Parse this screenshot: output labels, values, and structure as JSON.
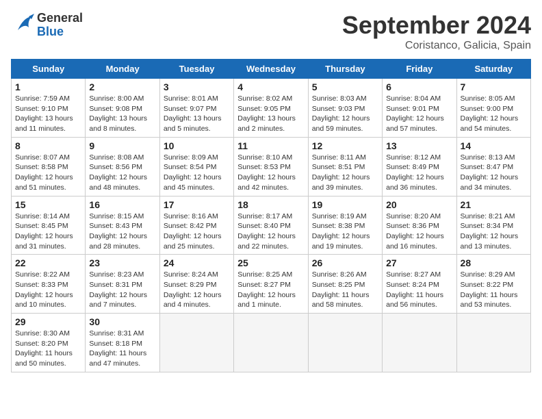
{
  "header": {
    "logo_text_general": "General",
    "logo_text_blue": "Blue",
    "month_title": "September 2024",
    "location": "Coristanco, Galicia, Spain"
  },
  "days_of_week": [
    "Sunday",
    "Monday",
    "Tuesday",
    "Wednesday",
    "Thursday",
    "Friday",
    "Saturday"
  ],
  "weeks": [
    [
      {
        "day": 1,
        "sunrise": "7:59 AM",
        "sunset": "9:10 PM",
        "daylight": "13 hours and 11 minutes."
      },
      {
        "day": 2,
        "sunrise": "8:00 AM",
        "sunset": "9:08 PM",
        "daylight": "13 hours and 8 minutes."
      },
      {
        "day": 3,
        "sunrise": "8:01 AM",
        "sunset": "9:07 PM",
        "daylight": "13 hours and 5 minutes."
      },
      {
        "day": 4,
        "sunrise": "8:02 AM",
        "sunset": "9:05 PM",
        "daylight": "13 hours and 2 minutes."
      },
      {
        "day": 5,
        "sunrise": "8:03 AM",
        "sunset": "9:03 PM",
        "daylight": "12 hours and 59 minutes."
      },
      {
        "day": 6,
        "sunrise": "8:04 AM",
        "sunset": "9:01 PM",
        "daylight": "12 hours and 57 minutes."
      },
      {
        "day": 7,
        "sunrise": "8:05 AM",
        "sunset": "9:00 PM",
        "daylight": "12 hours and 54 minutes."
      }
    ],
    [
      {
        "day": 8,
        "sunrise": "8:07 AM",
        "sunset": "8:58 PM",
        "daylight": "12 hours and 51 minutes."
      },
      {
        "day": 9,
        "sunrise": "8:08 AM",
        "sunset": "8:56 PM",
        "daylight": "12 hours and 48 minutes."
      },
      {
        "day": 10,
        "sunrise": "8:09 AM",
        "sunset": "8:54 PM",
        "daylight": "12 hours and 45 minutes."
      },
      {
        "day": 11,
        "sunrise": "8:10 AM",
        "sunset": "8:53 PM",
        "daylight": "12 hours and 42 minutes."
      },
      {
        "day": 12,
        "sunrise": "8:11 AM",
        "sunset": "8:51 PM",
        "daylight": "12 hours and 39 minutes."
      },
      {
        "day": 13,
        "sunrise": "8:12 AM",
        "sunset": "8:49 PM",
        "daylight": "12 hours and 36 minutes."
      },
      {
        "day": 14,
        "sunrise": "8:13 AM",
        "sunset": "8:47 PM",
        "daylight": "12 hours and 34 minutes."
      }
    ],
    [
      {
        "day": 15,
        "sunrise": "8:14 AM",
        "sunset": "8:45 PM",
        "daylight": "12 hours and 31 minutes."
      },
      {
        "day": 16,
        "sunrise": "8:15 AM",
        "sunset": "8:43 PM",
        "daylight": "12 hours and 28 minutes."
      },
      {
        "day": 17,
        "sunrise": "8:16 AM",
        "sunset": "8:42 PM",
        "daylight": "12 hours and 25 minutes."
      },
      {
        "day": 18,
        "sunrise": "8:17 AM",
        "sunset": "8:40 PM",
        "daylight": "12 hours and 22 minutes."
      },
      {
        "day": 19,
        "sunrise": "8:19 AM",
        "sunset": "8:38 PM",
        "daylight": "12 hours and 19 minutes."
      },
      {
        "day": 20,
        "sunrise": "8:20 AM",
        "sunset": "8:36 PM",
        "daylight": "12 hours and 16 minutes."
      },
      {
        "day": 21,
        "sunrise": "8:21 AM",
        "sunset": "8:34 PM",
        "daylight": "12 hours and 13 minutes."
      }
    ],
    [
      {
        "day": 22,
        "sunrise": "8:22 AM",
        "sunset": "8:33 PM",
        "daylight": "12 hours and 10 minutes."
      },
      {
        "day": 23,
        "sunrise": "8:23 AM",
        "sunset": "8:31 PM",
        "daylight": "12 hours and 7 minutes."
      },
      {
        "day": 24,
        "sunrise": "8:24 AM",
        "sunset": "8:29 PM",
        "daylight": "12 hours and 4 minutes."
      },
      {
        "day": 25,
        "sunrise": "8:25 AM",
        "sunset": "8:27 PM",
        "daylight": "12 hours and 1 minute."
      },
      {
        "day": 26,
        "sunrise": "8:26 AM",
        "sunset": "8:25 PM",
        "daylight": "11 hours and 58 minutes."
      },
      {
        "day": 27,
        "sunrise": "8:27 AM",
        "sunset": "8:24 PM",
        "daylight": "11 hours and 56 minutes."
      },
      {
        "day": 28,
        "sunrise": "8:29 AM",
        "sunset": "8:22 PM",
        "daylight": "11 hours and 53 minutes."
      }
    ],
    [
      {
        "day": 29,
        "sunrise": "8:30 AM",
        "sunset": "8:20 PM",
        "daylight": "11 hours and 50 minutes."
      },
      {
        "day": 30,
        "sunrise": "8:31 AM",
        "sunset": "8:18 PM",
        "daylight": "11 hours and 47 minutes."
      },
      null,
      null,
      null,
      null,
      null
    ]
  ]
}
